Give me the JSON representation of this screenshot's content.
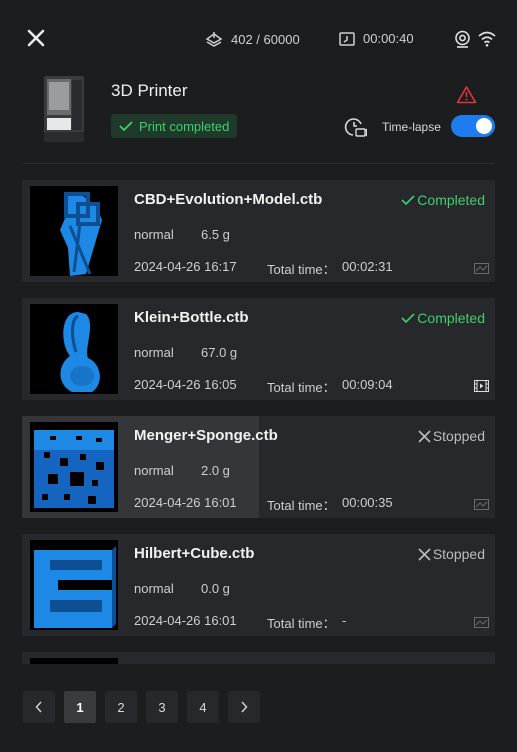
{
  "top_bar": {
    "layers": "402 / 60000",
    "elapsed": "00:00:40",
    "icons": [
      "close-icon",
      "layers-icon",
      "clock-icon",
      "camera-icon",
      "wifi-icon"
    ]
  },
  "printer": {
    "name": "3D Printer",
    "status": "Print completed",
    "timelapse_label": "Time-lapse",
    "timelapse_on": true
  },
  "colors": {
    "accent": "#1f7cf0",
    "success": "#3fcf6e",
    "warning": "#e0353a",
    "model": "#1e88e5"
  },
  "history": [
    {
      "file": "CBD+Evolution+Model.ctb",
      "status": "Completed",
      "state": "completed",
      "mode": "normal",
      "weight": "6.5 g",
      "date": "2024-04-26 16:17",
      "total_label": "Total time：",
      "total": "00:02:31",
      "media_icon": "image-placeholder-icon"
    },
    {
      "file": "Klein+Bottle.ctb",
      "status": "Completed",
      "state": "completed",
      "mode": "normal",
      "weight": "67.0 g",
      "date": "2024-04-26 16:05",
      "total_label": "Total time：",
      "total": "00:09:04",
      "media_icon": "video-icon"
    },
    {
      "file": "Menger+Sponge.ctb",
      "status": "Stopped",
      "state": "stopped",
      "mode": "normal",
      "weight": "2.0 g",
      "date": "2024-04-26 16:01",
      "total_label": "Total time：",
      "total": "00:00:35",
      "media_icon": "image-placeholder-icon"
    },
    {
      "file": "Hilbert+Cube.ctb",
      "status": "Stopped",
      "state": "stopped",
      "mode": "normal",
      "weight": "0.0 g",
      "date": "2024-04-26 16:01",
      "total_label": "Total time：",
      "total": "-",
      "media_icon": "image-placeholder-icon"
    }
  ],
  "pagination": {
    "pages": [
      "1",
      "2",
      "3",
      "4"
    ],
    "current": "1"
  }
}
